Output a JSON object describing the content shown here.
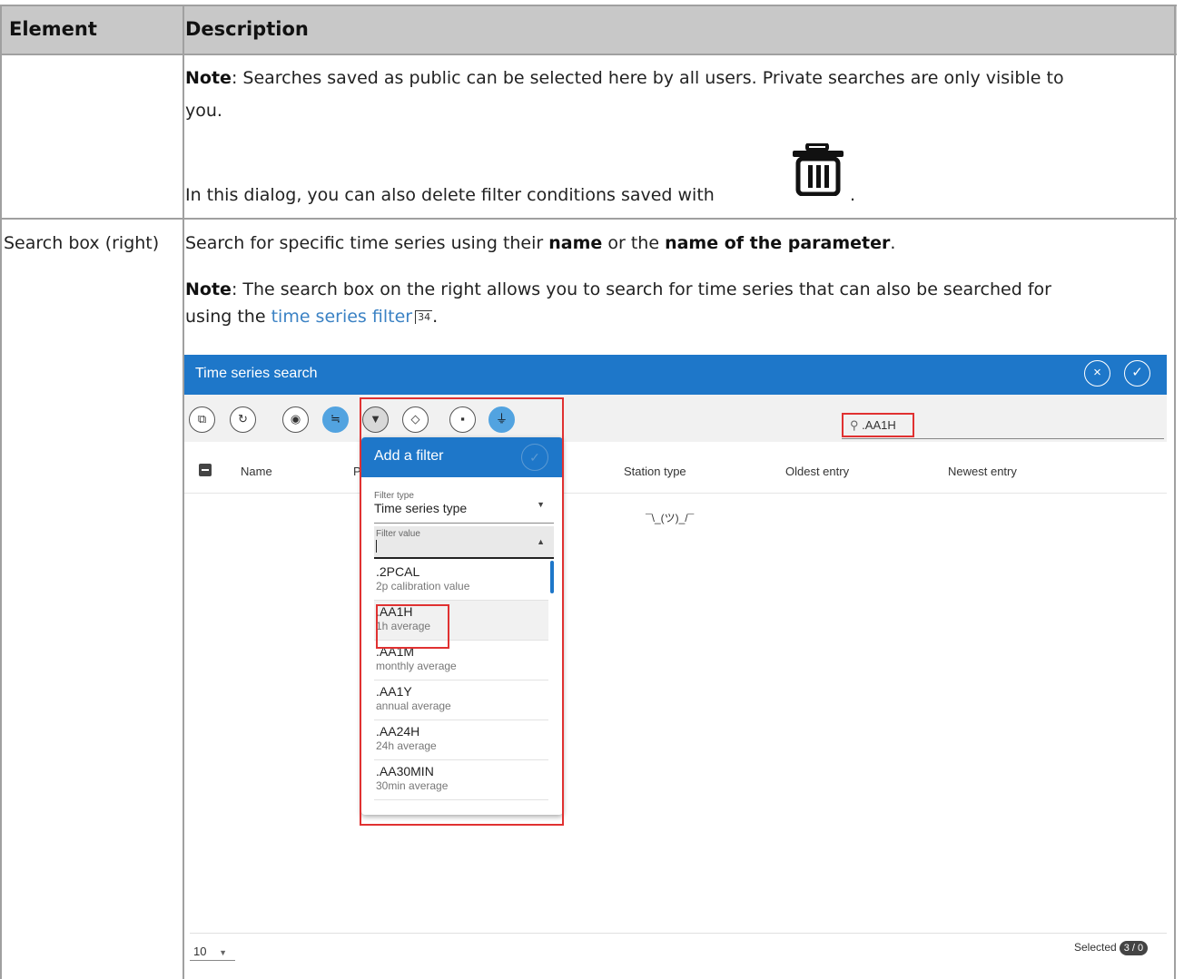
{
  "table": {
    "header": {
      "element": "Element",
      "description": "Description"
    },
    "row1": {
      "note_label": "Note",
      "note_text": ": Searches saved as public can be selected here by all users. Private searches are only visible to",
      "note_text2": "you.",
      "delete_text": "In this dialog, you can also delete filter conditions saved with",
      "delete_suffix": "."
    },
    "row2": {
      "element": "Search box (right)",
      "desc_pre": "Search for specific time series using their ",
      "desc_b1": "name",
      "desc_mid": " or the ",
      "desc_b2": "name of the parameter",
      "desc_post": ".",
      "note_label": "Note",
      "note_text": ": The search box on the right allows you to search for time series that can also be searched for",
      "note_line2_pre": "using the ",
      "note_link": "time series filter",
      "note_link_page": "34",
      "note_line2_post": "."
    }
  },
  "screenshot": {
    "title": "Time series search",
    "close_icon": "×",
    "confirm_icon": "✓",
    "search_value": ".AA1H",
    "columns": [
      "Name",
      "P",
      "Station type",
      "Oldest entry",
      "Newest entry"
    ],
    "empty_text": "¯\\_(ツ)_/¯",
    "page_size": "10",
    "selected_label": "Selected",
    "selected_badge": "3 / 0",
    "filter_popup": {
      "title": "Add a filter",
      "filter_type_label": "Filter type",
      "filter_type_value": "Time series type",
      "filter_value_label": "Filter value",
      "options": [
        {
          "name": ".2PCAL",
          "desc": "2p calibration value"
        },
        {
          "name": ".AA1H",
          "desc": "1h average"
        },
        {
          "name": ".AA1M",
          "desc": "monthly average"
        },
        {
          "name": ".AA1Y",
          "desc": "annual average"
        },
        {
          "name": ".AA24H",
          "desc": "24h average"
        },
        {
          "name": ".AA30MIN",
          "desc": "30min average"
        }
      ]
    }
  },
  "colors": {
    "accent": "#1e77c9",
    "highlight": "#e03131",
    "link": "#3b82c4"
  }
}
